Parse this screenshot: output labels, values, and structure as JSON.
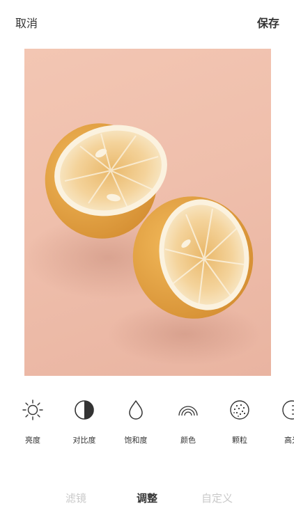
{
  "header": {
    "cancel_label": "取消",
    "save_label": "保存"
  },
  "photo": {
    "subject": "two halves of a dried lemon on a pink background",
    "background_color": "#efbfac",
    "rind_color": "#e9a84b",
    "flesh_color": "#f3d49a"
  },
  "tools": [
    {
      "label": "亮度",
      "icon": "brightness-sun-icon"
    },
    {
      "label": "对比度",
      "icon": "contrast-half-circle-icon"
    },
    {
      "label": "饱和度",
      "icon": "saturation-drop-icon"
    },
    {
      "label": "颜色",
      "icon": "color-rainbow-icon"
    },
    {
      "label": "颗粒",
      "icon": "grain-dots-icon"
    },
    {
      "label": "高光",
      "icon": "highlight-icon"
    }
  ],
  "tabs": [
    {
      "label": "滤镜",
      "active": false
    },
    {
      "label": "调整",
      "active": true
    },
    {
      "label": "自定义",
      "active": false
    }
  ]
}
